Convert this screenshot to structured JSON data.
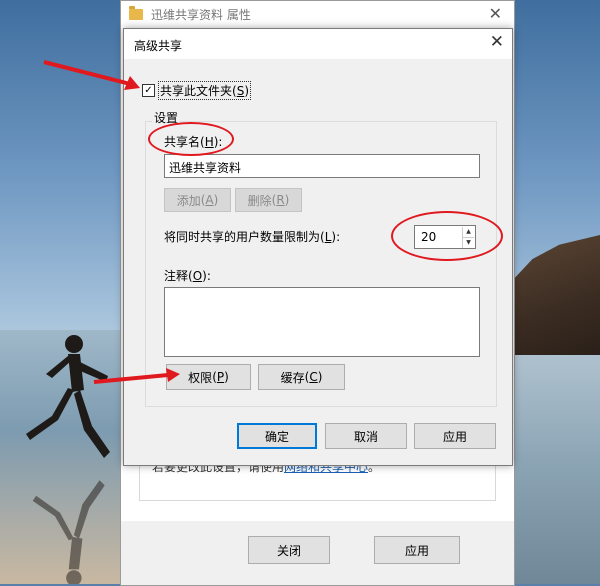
{
  "background_window": {
    "title": "迅维共享资料 属性",
    "info_text_prefix": "若要更改此设置，请使用",
    "info_link": "网络和共享中心",
    "info_text_suffix": "。",
    "close_button": "关闭",
    "apply_button": "应用"
  },
  "dialog": {
    "title": "高级共享",
    "share_checkbox": {
      "label": "共享此文件夹",
      "mnemonic": "S",
      "checked": true
    },
    "settings_group": "设置",
    "share_name": {
      "label": "共享名",
      "mnemonic": "H",
      "value": "迅维共享资料"
    },
    "add_button": {
      "label": "添加",
      "mnemonic": "A"
    },
    "remove_button": {
      "label": "删除",
      "mnemonic": "R"
    },
    "user_limit": {
      "label": "将同时共享的用户数量限制为",
      "mnemonic": "L",
      "value": "20"
    },
    "comment": {
      "label": "注释",
      "mnemonic": "O",
      "value": ""
    },
    "permissions_button": {
      "label": "权限",
      "mnemonic": "P"
    },
    "caching_button": {
      "label": "缓存",
      "mnemonic": "C"
    },
    "ok_button": "确定",
    "cancel_button": "取消",
    "apply_button": "应用"
  },
  "annotations": {
    "color": "#e0191e"
  },
  "icons": [
    "folder-icon",
    "close-icon",
    "checkmark-icon",
    "spin-up-icon",
    "spin-down-icon",
    "arrow-annotation-icon"
  ]
}
